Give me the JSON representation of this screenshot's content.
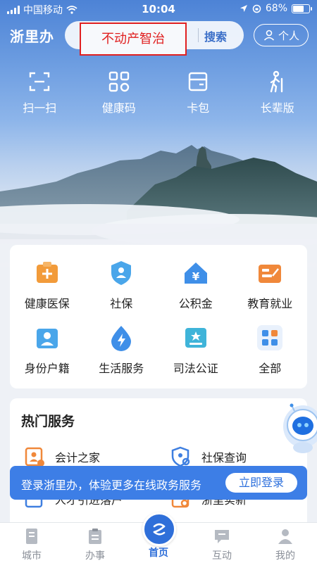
{
  "status_bar": {
    "carrier": "中国移动",
    "time": "10:04",
    "battery": "68%",
    "battery_level": 0.68
  },
  "header": {
    "app_title": "浙里办",
    "search_hint": "不动产智治",
    "search_button": "搜索",
    "personal_button": "个人"
  },
  "quick_actions": [
    {
      "label": "扫一扫",
      "icon": "scan-icon"
    },
    {
      "label": "健康码",
      "icon": "health-code-icon"
    },
    {
      "label": "卡包",
      "icon": "card-wallet-icon"
    },
    {
      "label": "长辈版",
      "icon": "elder-mode-icon"
    }
  ],
  "services": [
    {
      "label": "健康医保",
      "icon": "medical-insurance-icon"
    },
    {
      "label": "社保",
      "icon": "social-security-icon"
    },
    {
      "label": "公积金",
      "icon": "housing-fund-icon"
    },
    {
      "label": "教育就业",
      "icon": "education-employment-icon"
    },
    {
      "label": "身份户籍",
      "icon": "identity-household-icon"
    },
    {
      "label": "生活服务",
      "icon": "life-services-icon"
    },
    {
      "label": "司法公证",
      "icon": "judicial-notary-icon"
    },
    {
      "label": "全部",
      "icon": "all-services-icon"
    }
  ],
  "hot_services": {
    "title": "热门服务",
    "items": [
      {
        "label": "会计之家",
        "icon": "accountant-home-icon"
      },
      {
        "label": "社保查询",
        "icon": "social-security-query-icon"
      },
      {
        "label": "人才引进落户",
        "icon": "talent-settlement-icon"
      },
      {
        "label": "浙里实新",
        "icon": "zheli-shixin-icon"
      }
    ]
  },
  "login_banner": {
    "text": "登录浙里办，体验更多在线政务服务",
    "button": "立即登录"
  },
  "tabs": [
    {
      "label": "城市",
      "icon": "city-icon"
    },
    {
      "label": "办事",
      "icon": "affairs-icon"
    },
    {
      "label": "首页",
      "icon": "home-icon",
      "active": true
    },
    {
      "label": "互动",
      "icon": "interaction-icon"
    },
    {
      "label": "我的",
      "icon": "profile-icon"
    }
  ],
  "colors": {
    "brand_blue": "#2f6fd9",
    "highlight_red": "#e02020",
    "banner_blue": "#3d7ee6"
  }
}
